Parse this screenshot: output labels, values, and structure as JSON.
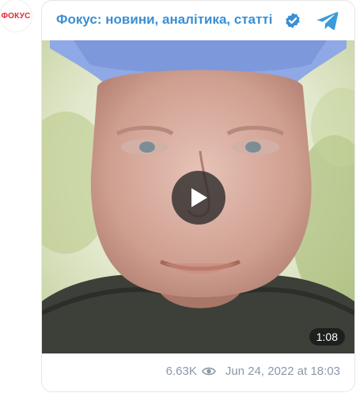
{
  "avatar": {
    "text": "ФОКУС"
  },
  "post": {
    "channel_title": "Фокус: новини, аналітика, статті",
    "video_duration": "1:08",
    "views": "6.63K",
    "date": "Jun 24, 2022 at 18:03"
  },
  "colors": {
    "accent": "#3a8fd4",
    "brand_red": "#e3262f",
    "meta_text": "#8a98a8"
  },
  "icons": [
    "verified-icon",
    "telegram-icon",
    "play-icon",
    "eye-icon"
  ]
}
